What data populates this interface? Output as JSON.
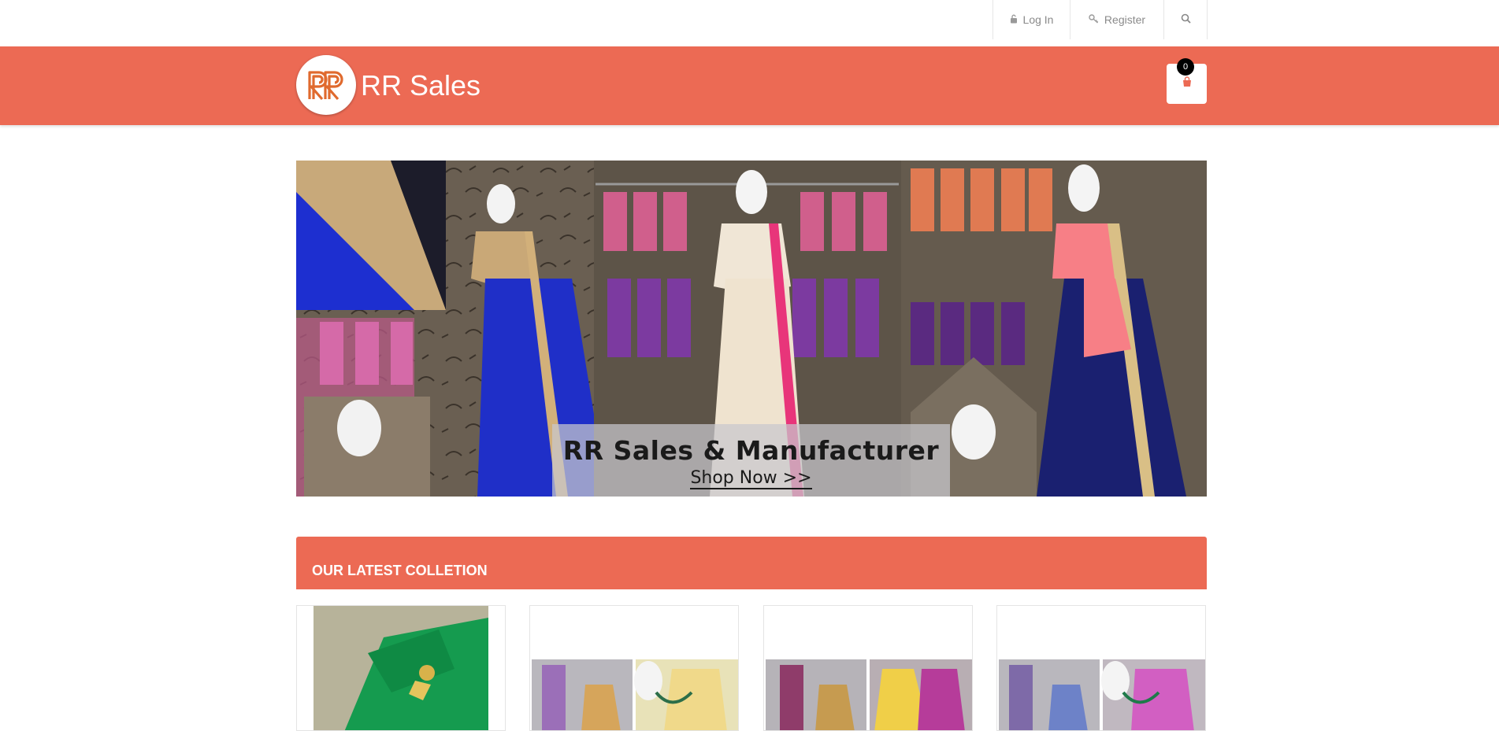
{
  "topnav": {
    "login": {
      "label": "Log In",
      "icon": "lock-icon"
    },
    "register": {
      "label": "Register",
      "icon": "key-icon"
    },
    "search": {
      "icon": "search-icon"
    }
  },
  "brand": {
    "name": "RR Sales",
    "logo_letters": "RR",
    "accent_color": "#ec6a54"
  },
  "cart": {
    "count": "0",
    "icon": "shopping-bag-icon"
  },
  "banner": {
    "title": "RR Sales & Manufacturer",
    "cta": "Shop Now >>"
  },
  "section": {
    "title": "OUR LATEST COLLETION"
  },
  "products": [
    {
      "image": "green-saree-product-image"
    },
    {
      "image": "silk-saree-mannequin-product-image"
    },
    {
      "image": "silk-saree-mannequin-product-image"
    },
    {
      "image": "silk-saree-mannequin-product-image"
    }
  ]
}
